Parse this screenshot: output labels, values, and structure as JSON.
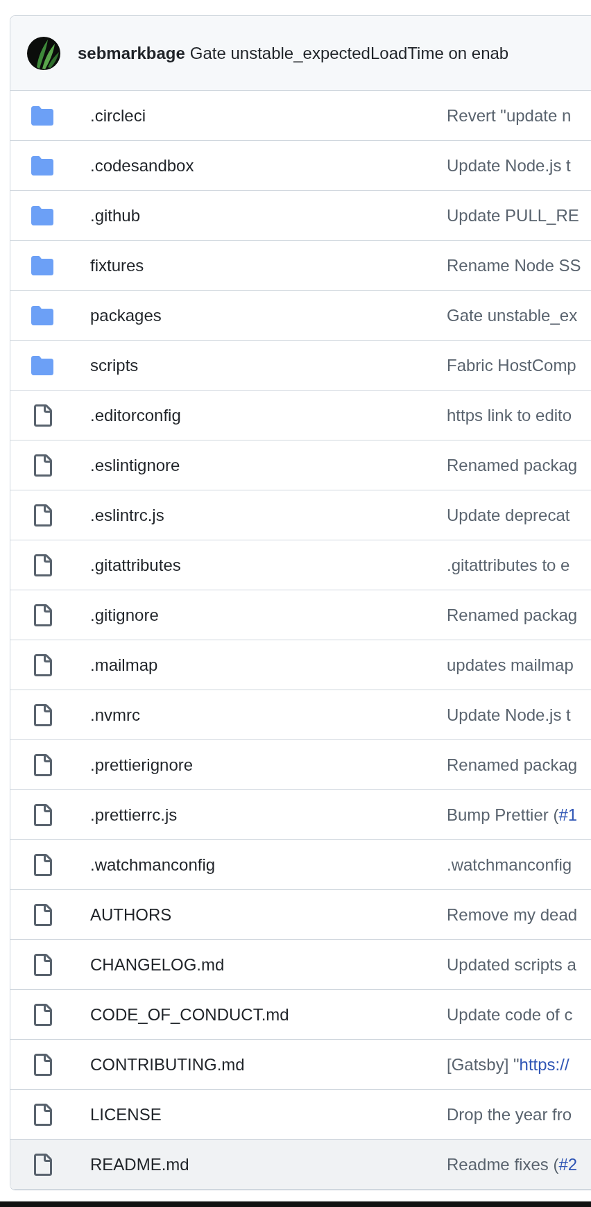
{
  "commit": {
    "author": "sebmarkbage",
    "message": "Gate unstable_expectedLoadTime on enab"
  },
  "files": [
    {
      "kind": "folder",
      "name": ".circleci",
      "message": "Revert \"update n",
      "highlighted": false
    },
    {
      "kind": "folder",
      "name": ".codesandbox",
      "message": "Update Node.js t",
      "highlighted": false
    },
    {
      "kind": "folder",
      "name": ".github",
      "message": "Update PULL_RE",
      "highlighted": false
    },
    {
      "kind": "folder",
      "name": "fixtures",
      "message": "Rename Node SS",
      "highlighted": false
    },
    {
      "kind": "folder",
      "name": "packages",
      "message": "Gate unstable_ex",
      "highlighted": false
    },
    {
      "kind": "folder",
      "name": "scripts",
      "message": "Fabric HostComp",
      "highlighted": false
    },
    {
      "kind": "file",
      "name": ".editorconfig",
      "message": "https link to edito",
      "highlighted": false
    },
    {
      "kind": "file",
      "name": ".eslintignore",
      "message": "Renamed packag",
      "highlighted": false
    },
    {
      "kind": "file",
      "name": ".eslintrc.js",
      "message": "Update deprecat",
      "highlighted": false
    },
    {
      "kind": "file",
      "name": ".gitattributes",
      "message": ".gitattributes to e",
      "highlighted": false
    },
    {
      "kind": "file",
      "name": ".gitignore",
      "message": "Renamed packag",
      "highlighted": false
    },
    {
      "kind": "file",
      "name": ".mailmap",
      "message": "updates mailmap",
      "highlighted": false
    },
    {
      "kind": "file",
      "name": ".nvmrc",
      "message": "Update Node.js t",
      "highlighted": false
    },
    {
      "kind": "file",
      "name": ".prettierignore",
      "message": "Renamed packag",
      "highlighted": false
    },
    {
      "kind": "file",
      "name": ".prettierrc.js",
      "message": "Bump Prettier (",
      "link": "#1",
      "highlighted": false
    },
    {
      "kind": "file",
      "name": ".watchmanconfig",
      "message": ".watchmanconfig",
      "highlighted": false
    },
    {
      "kind": "file",
      "name": "AUTHORS",
      "message": "Remove my dead",
      "highlighted": false
    },
    {
      "kind": "file",
      "name": "CHANGELOG.md",
      "message": "Updated scripts a",
      "highlighted": false
    },
    {
      "kind": "file",
      "name": "CODE_OF_CONDUCT.md",
      "message": "Update code of c",
      "highlighted": false
    },
    {
      "kind": "file",
      "name": "CONTRIBUTING.md",
      "message": "[Gatsby] \"",
      "link": "https://",
      "highlighted": false
    },
    {
      "kind": "file",
      "name": "LICENSE",
      "message": "Drop the year fro",
      "highlighted": false
    },
    {
      "kind": "file",
      "name": "README.md",
      "message": "Readme fixes (",
      "link": "#2",
      "highlighted": true
    }
  ]
}
